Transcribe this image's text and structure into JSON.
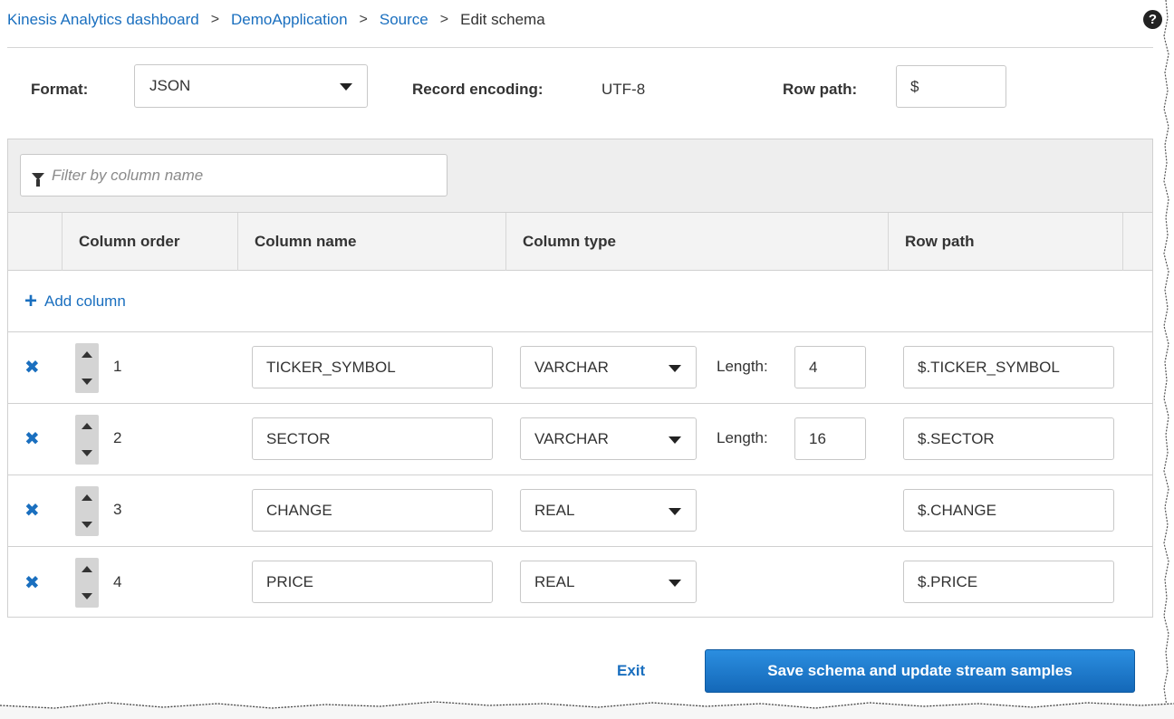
{
  "breadcrumb": {
    "items": [
      "Kinesis Analytics dashboard",
      "DemoApplication",
      "Source"
    ],
    "current": "Edit schema",
    "separator": ">"
  },
  "help_icon": {
    "glyph": "?",
    "icon": "question-circle-icon"
  },
  "settings": {
    "format_label": "Format:",
    "format_value": "JSON",
    "record_encoding_label": "Record encoding:",
    "record_encoding_value": "UTF-8",
    "row_path_label": "Row path:",
    "row_path_value": "$"
  },
  "filter": {
    "placeholder": "Filter by column name",
    "icon": "filter-icon"
  },
  "table": {
    "headers": {
      "column_order": "Column order",
      "column_name": "Column name",
      "column_type": "Column type",
      "row_path": "Row path"
    },
    "add_column_label": "Add column",
    "length_label": "Length:",
    "rows": [
      {
        "order": "1",
        "name": "TICKER_SYMBOL",
        "type": "VARCHAR",
        "length": "4",
        "row_path": "$.TICKER_SYMBOL"
      },
      {
        "order": "2",
        "name": "SECTOR",
        "type": "VARCHAR",
        "length": "16",
        "row_path": "$.SECTOR"
      },
      {
        "order": "3",
        "name": "CHANGE",
        "type": "REAL",
        "length": null,
        "row_path": "$.CHANGE"
      },
      {
        "order": "4",
        "name": "PRICE",
        "type": "REAL",
        "length": null,
        "row_path": "$.PRICE"
      }
    ]
  },
  "actions": {
    "exit_label": "Exit",
    "save_label": "Save schema and update stream samples"
  },
  "colors": {
    "link": "#1a6fbf",
    "primary_button": "#1a73c8",
    "header_bg": "#f3f3f3",
    "filter_bar_bg": "#eeeeee"
  }
}
